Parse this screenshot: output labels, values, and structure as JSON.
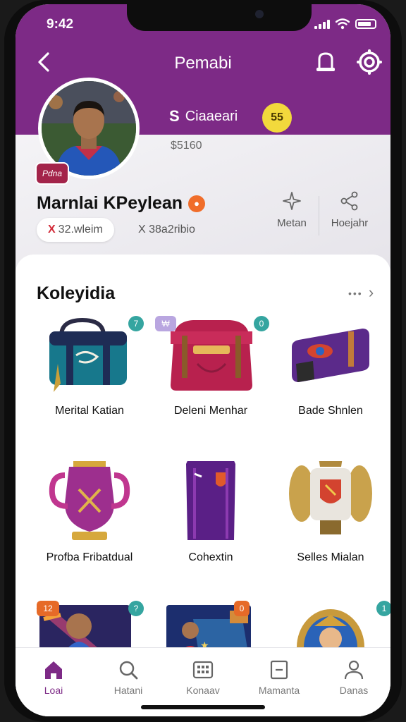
{
  "status_bar": {
    "time": "9:42"
  },
  "header": {
    "title": "Pemabi",
    "back_icon": "chevron-left-icon",
    "bell_icon": "bell-icon",
    "settings_icon": "gear-icon"
  },
  "profile": {
    "avatar_badge": "Pdna",
    "club_symbol": "S",
    "club_name": "Ciaaeari",
    "coin_value": "55",
    "value": "$5160",
    "name": "Marnlai KPeylean",
    "name_badge": "●",
    "pill_x": "X",
    "pill_text": "32.wleim",
    "sub_info": "X 38a2ribio",
    "actions": [
      {
        "label": "Metan",
        "icon": "star-icon"
      },
      {
        "label": "Hoejahr",
        "icon": "share-icon"
      }
    ]
  },
  "collection": {
    "title": "Koleyidia",
    "more_label": "•••",
    "items": [
      {
        "label": "Merital Katian",
        "tag": "7"
      },
      {
        "label": "Deleni Menhar",
        "tag": "0",
        "corner_tag": "₩"
      },
      {
        "label": "Bade Shnlen"
      },
      {
        "label": "Profba Fribatdual"
      },
      {
        "label": "Cohextin"
      },
      {
        "label": "Selles Mialan"
      },
      {
        "label": "",
        "tag": "?",
        "corner_tag": "12"
      },
      {
        "label": "",
        "corner_tag": "0"
      },
      {
        "label": "",
        "tag": "1"
      }
    ]
  },
  "tabbar": {
    "tabs": [
      {
        "label": "Loai",
        "icon": "home-icon",
        "active": true
      },
      {
        "label": "Hatani",
        "icon": "search-icon"
      },
      {
        "label": "Konaav",
        "icon": "grid-icon"
      },
      {
        "label": "Mamanta",
        "icon": "document-icon"
      },
      {
        "label": "Danas",
        "icon": "person-icon"
      }
    ]
  },
  "colors": {
    "brand": "#7d2a86",
    "accent": "#f06d2a",
    "coin": "#f2d93c",
    "tag": "#35a5a0"
  }
}
